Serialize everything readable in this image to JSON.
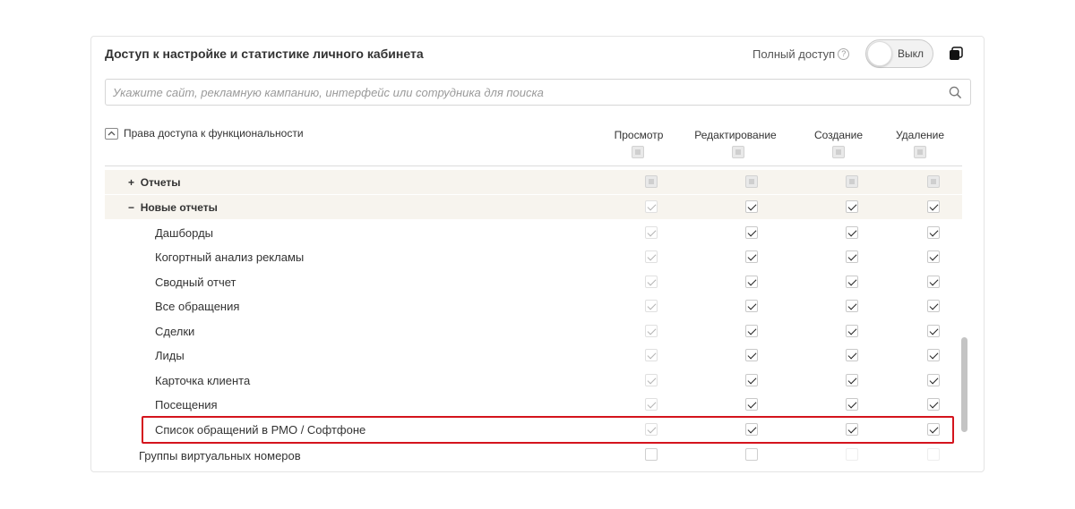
{
  "panel": {
    "title": "Доступ к настройке и статистике личного кабинета",
    "full_access_label": "Полный доступ",
    "help_icon": "?",
    "toggle_label": "Выкл",
    "search_placeholder": "Укажите сайт, рекламную кампанию, интерфейс или сотрудника для поиска"
  },
  "table": {
    "section_label": "Права доступа к функциональности",
    "columns": [
      "Просмотр",
      "Редактирование",
      "Создание",
      "Удаление"
    ],
    "rows": [
      {
        "prefix": "+",
        "label": "Отчеты",
        "kind": "group"
      },
      {
        "prefix": "−",
        "label": "Новые отчеты",
        "kind": "group"
      },
      {
        "label": "Дашборды",
        "kind": "item"
      },
      {
        "label": "Когортный анализ рекламы",
        "kind": "item"
      },
      {
        "label": "Сводный отчет",
        "kind": "item"
      },
      {
        "label": "Все обращения",
        "kind": "item"
      },
      {
        "label": "Сделки",
        "kind": "item"
      },
      {
        "label": "Лиды",
        "kind": "item"
      },
      {
        "label": "Карточка клиента",
        "kind": "item"
      },
      {
        "label": "Посещения",
        "kind": "item"
      },
      {
        "label": "Список обращений в РМО / Софтфоне",
        "kind": "item",
        "highlighted": true
      },
      {
        "label": "Группы виртуальных номеров",
        "kind": "outer"
      }
    ]
  },
  "colors": {
    "highlight": "#d4141d",
    "group_row_bg": "#f7f4ee"
  },
  "icons": [
    "help-icon",
    "copy-icon",
    "search-icon",
    "chevron-up-icon",
    "checkbox-icon"
  ]
}
